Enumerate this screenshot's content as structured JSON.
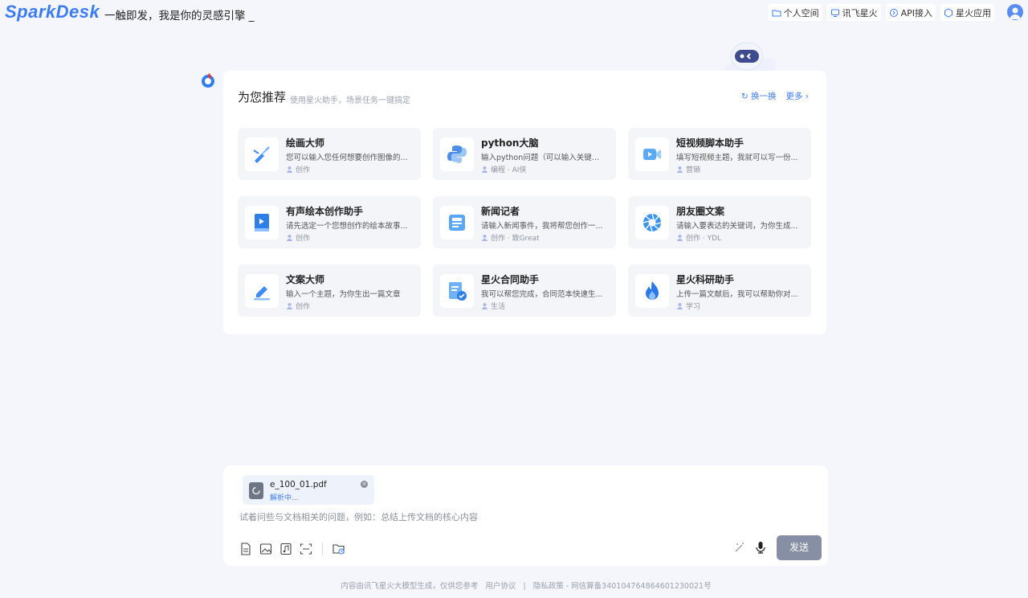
{
  "header": {
    "logo": "SparkDesk",
    "slogan": "一触即发，我是你的灵感引擎 _",
    "nav": [
      "个人空间",
      "讯飞星火",
      "API接入",
      "星火应用"
    ]
  },
  "panel": {
    "title": "为您推荐",
    "subtitle": "使用星火助手，场景任务一键搞定",
    "refresh": "换一换",
    "more": "更多"
  },
  "cards": [
    {
      "title": "绘画大师",
      "desc": "您可以输入您任何想要创作图像的...",
      "meta": "创作",
      "icon": "paint-brush-icon"
    },
    {
      "title": "python大脑",
      "desc": "输入python问题（可以输入关键词...",
      "meta": "编程 · AI侠",
      "icon": "python-icon"
    },
    {
      "title": "短视频脚本助手",
      "desc": "填写短视频主题，我就可以写一份...",
      "meta": "营销",
      "icon": "video-icon"
    },
    {
      "title": "有声绘本创作助手",
      "desc": "请先选定一个您想创作的绘本故事...",
      "meta": "创作",
      "icon": "book-icon"
    },
    {
      "title": "新闻记者",
      "desc": "请输入新闻事件，我将帮您创作一...",
      "meta": "创作 · 致Great",
      "icon": "news-icon"
    },
    {
      "title": "朋友圈文案",
      "desc": "请输入要表达的关键词，为你生成...",
      "meta": "创作 · YDL",
      "icon": "aperture-icon"
    },
    {
      "title": "文案大师",
      "desc": "输入一个主题，为你生出一篇文章",
      "meta": "创作",
      "icon": "pen-icon"
    },
    {
      "title": "星火合同助手",
      "desc": "我可以帮您完成，合同范本快速生...",
      "meta": "生活",
      "icon": "contract-icon"
    },
    {
      "title": "星火科研助手",
      "desc": "上传一篇文献后，我可以帮助你对...",
      "meta": "学习",
      "icon": "flame-icon"
    }
  ],
  "input": {
    "file_name": "e_100_01.pdf",
    "file_status": "解析中...",
    "placeholder": "试着问些与文档相关的问题，例如：总结上传文档的核心内容",
    "send": "发送"
  },
  "footer": {
    "disclaimer": "内容由讯飞星火大模型生成，仅供您参考",
    "agreement": "用户协议",
    "divider": "|",
    "privacy": "隐私政策 - 网信算备340104764864601230021号"
  },
  "colors": {
    "accent": "#3b7cf5",
    "send_bg": "#868fa4",
    "page_bg": "#f5f6fb"
  }
}
